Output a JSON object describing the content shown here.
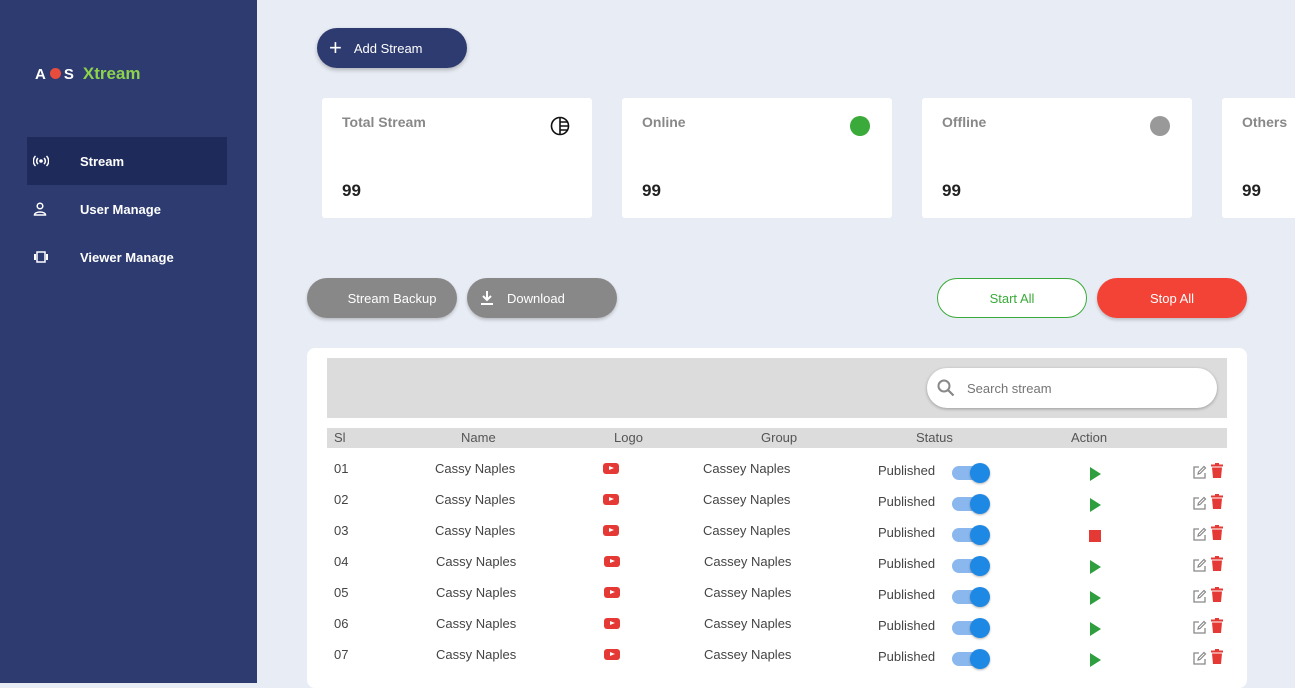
{
  "brand": {
    "letters_left": "A",
    "letters_right": "S",
    "name": "Xtream"
  },
  "sidebar": {
    "items": [
      {
        "label": "Stream",
        "icon": "broadcast-icon",
        "active": true
      },
      {
        "label": "User Manage",
        "icon": "user-icon",
        "active": false
      },
      {
        "label": "Viewer Manage",
        "icon": "viewer-icon",
        "active": false
      }
    ]
  },
  "header": {
    "add_stream_label": "Add Stream"
  },
  "stats": [
    {
      "title": "Total Stream",
      "value": "99",
      "indicator": "pie-chart-icon"
    },
    {
      "title": "Online",
      "value": "99",
      "indicator_color": "#3aaa3a"
    },
    {
      "title": "Offline",
      "value": "99",
      "indicator_color": "#999999"
    },
    {
      "title": "Others",
      "value": "99"
    }
  ],
  "actions": {
    "backup_label": "Stream Backup",
    "download_label": "Download",
    "start_all_label": "Start All",
    "stop_all_label": "Stop All"
  },
  "search": {
    "placeholder": "Search stream"
  },
  "table": {
    "columns": [
      "Sl",
      "Name",
      "Logo",
      "Group",
      "Status",
      "Action"
    ],
    "rows": [
      {
        "sl": "01",
        "name": "Cassy Naples",
        "group": "Cassey Naples",
        "status": "Published",
        "enabled": true,
        "action": "play"
      },
      {
        "sl": "02",
        "name": "Cassy Naples",
        "group": "Cassey Naples",
        "status": "Published",
        "enabled": true,
        "action": "play"
      },
      {
        "sl": "03",
        "name": "Cassy Naples",
        "group": "Cassey Naples",
        "status": "Published",
        "enabled": true,
        "action": "stop"
      },
      {
        "sl": "04",
        "name": "Cassy Naples",
        "group": "Cassey Naples",
        "status": "Published",
        "enabled": true,
        "action": "play"
      },
      {
        "sl": "05",
        "name": "Cassy Naples",
        "group": "Cassey Naples",
        "status": "Published",
        "enabled": true,
        "action": "play"
      },
      {
        "sl": "06",
        "name": "Cassy Naples",
        "group": "Cassey Naples",
        "status": "Published",
        "enabled": true,
        "action": "play"
      },
      {
        "sl": "07",
        "name": "Cassy Naples",
        "group": "Cassey Naples",
        "status": "Published",
        "enabled": true,
        "action": "play"
      }
    ]
  },
  "colors": {
    "sidebar": "#2d3b70",
    "accent_green": "#3aaa3a",
    "danger": "#f34336",
    "toggle": "#1e88e5"
  }
}
